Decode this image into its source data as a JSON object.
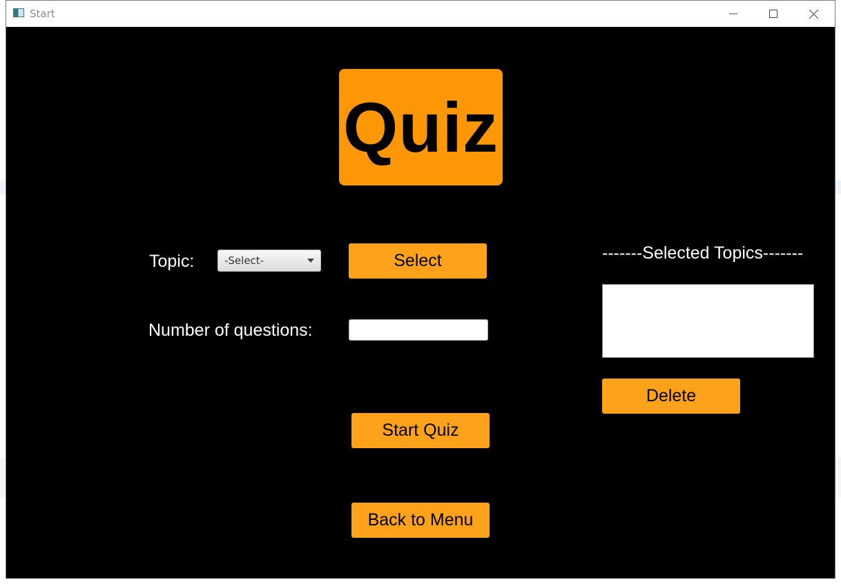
{
  "window": {
    "title": "Start"
  },
  "logo": {
    "text": "Quiz"
  },
  "form": {
    "topic_label": "Topic:",
    "topic_select_value": "-Select-",
    "select_button": "Select",
    "questions_label": "Number of questions:",
    "questions_value": "",
    "start_button": "Start Quiz",
    "back_button": "Back to Menu"
  },
  "topics_panel": {
    "header": "-------Selected Topics-------",
    "items": [],
    "delete_button": "Delete"
  },
  "colors": {
    "accent": "#fea21c",
    "logo_bg": "#fd9705",
    "background": "#000000"
  }
}
